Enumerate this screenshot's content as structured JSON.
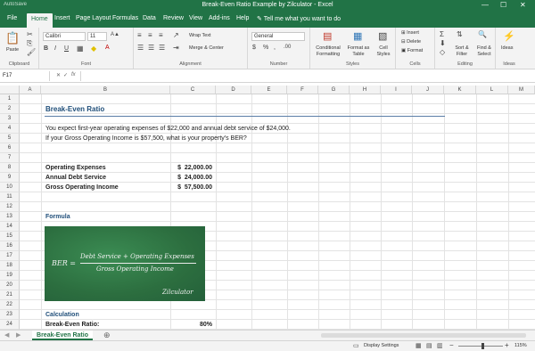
{
  "window": {
    "title": "Break-Even Ratio Example by Zilculator  -  Excel",
    "autosave": "AutoSave",
    "min": "—",
    "max": "☐",
    "close": "✕"
  },
  "tabs": [
    "File",
    "Home",
    "Insert",
    "Page Layout",
    "Formulas",
    "Data",
    "Review",
    "View",
    "Add-ins",
    "Help"
  ],
  "tell_me": "Tell me what you want to do",
  "ribbon": {
    "clipboard": {
      "label": "Clipboard",
      "paste": "Paste"
    },
    "font": {
      "label": "Font",
      "name": "Calibri",
      "size": "11"
    },
    "alignment": {
      "label": "Alignment",
      "wrap": "Wrap Text",
      "merge": "Merge & Center"
    },
    "number": {
      "label": "Number",
      "format": "General"
    },
    "styles": {
      "label": "Styles",
      "conditional": "Conditional Formatting",
      "format_table": "Format as Table",
      "cell_styles": "Cell Styles"
    },
    "cells": {
      "label": "Cells",
      "insert": "Insert",
      "delete": "Delete",
      "format": "Format"
    },
    "editing": {
      "label": "Editing",
      "sort": "Sort & Filter",
      "find": "Find & Select"
    },
    "ideas": {
      "label": "Ideas",
      "btn": "Ideas"
    }
  },
  "formula_bar": {
    "name_box": "F17",
    "value": ""
  },
  "columns": [
    "A",
    "B",
    "C",
    "D",
    "E",
    "F",
    "G",
    "H",
    "I",
    "J",
    "K",
    "L",
    "M"
  ],
  "rows": [
    "1",
    "2",
    "3",
    "4",
    "5",
    "6",
    "7",
    "8",
    "9",
    "10",
    "11",
    "12",
    "13",
    "14",
    "15",
    "16",
    "17",
    "18",
    "19",
    "20",
    "21",
    "22",
    "23",
    "24"
  ],
  "sheet": {
    "title": "Break-Even Ratio",
    "line1": "You expect first-year operating expenses of $22,000 and annual debt service of $24,000.",
    "line2": "If your Gross Operating Income is $57,500, what is your property's BER?",
    "items": [
      {
        "label": "Operating Expenses",
        "value": "$  22,000.00"
      },
      {
        "label": "Annual Debt Service",
        "value": "$  24,000.00"
      },
      {
        "label": "Gross Operating Income",
        "value": "$  57,500.00"
      }
    ],
    "formula_heading": "Formula",
    "chalk": {
      "lhs": "BER =",
      "numerator": "Debt Service + Operating Expenses",
      "denominator": "Gross Operating Income",
      "brand": "Zilculator"
    },
    "calc_heading": "Calculation",
    "result_label": "Break-Even Ratio:",
    "result_value": "80%"
  },
  "sheet_tab": "Break-Even Ratio",
  "status": {
    "display_settings": "Display Settings",
    "zoom": "115%"
  },
  "colors": {
    "excel_green": "#217346",
    "heading_blue": "#1f4e79",
    "chalkboard": "#2f7a45"
  }
}
